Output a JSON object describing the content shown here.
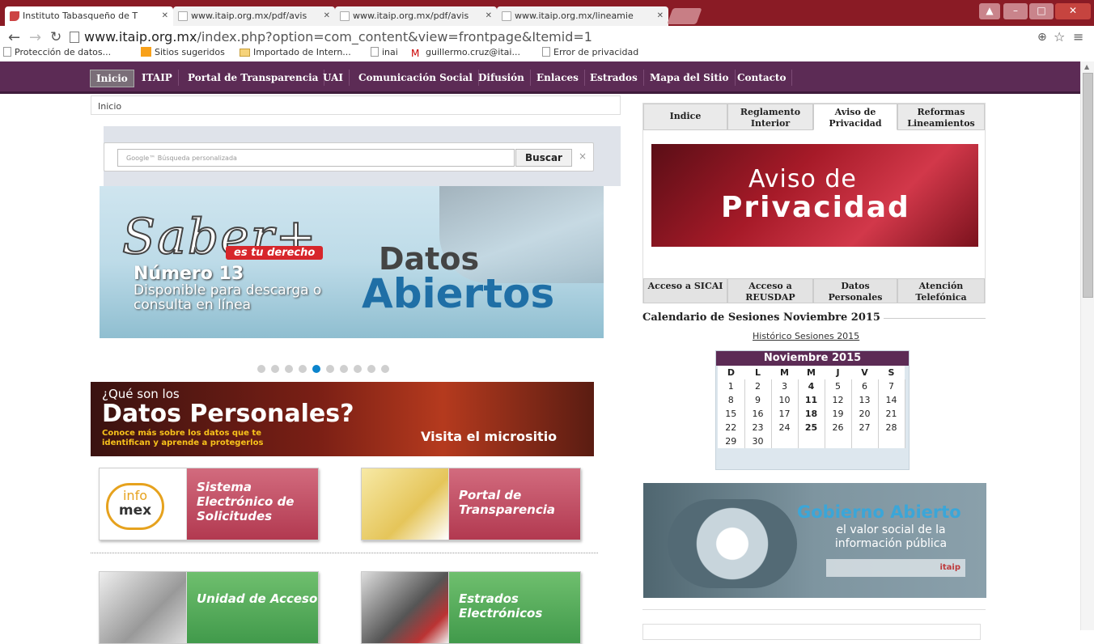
{
  "browser": {
    "tabs": [
      {
        "title": "Instituto Tabasqueño de T"
      },
      {
        "title": "www.itaip.org.mx/pdf/avis"
      },
      {
        "title": "www.itaip.org.mx/pdf/avis"
      },
      {
        "title": "www.itaip.org.mx/lineamie"
      }
    ],
    "url_domain": "www.itaip.org.mx",
    "url_path": "/index.php?option=com_content&view=frontpage&Itemid=1",
    "bookmarks": [
      {
        "label": "Protección de datos..."
      },
      {
        "label": "Sitios sugeridos"
      },
      {
        "label": "Importado de Intern..."
      },
      {
        "label": "inai"
      },
      {
        "label": "guillermo.cruz@itai..."
      },
      {
        "label": "Error de privacidad"
      }
    ]
  },
  "nav": {
    "items": [
      {
        "label": "Inicio"
      },
      {
        "label": "ITAIP"
      },
      {
        "label": "Portal de Transparencia"
      },
      {
        "label": "UAI"
      },
      {
        "label": "Comunicación Social"
      },
      {
        "label": "Difusión"
      },
      {
        "label": "Enlaces"
      },
      {
        "label": "Estrados"
      },
      {
        "label": "Mapa del Sitio"
      },
      {
        "label": "Contacto"
      }
    ]
  },
  "breadcrumb": "Inicio",
  "search": {
    "placeholder": "Google™ Búsqueda personalizada",
    "button": "Buscar",
    "clear": "×"
  },
  "banner": {
    "saber": "Saber+",
    "derecho": "es tu derecho",
    "numero": "Número 13",
    "disponible": "Disponible para descarga o consulta en línea",
    "datos": "Datos",
    "abiertos": "Abiertos"
  },
  "slider": {
    "count": 10,
    "active": 5
  },
  "datos_personales": {
    "question": "¿Qué son los",
    "title": "Datos Personales?",
    "sub": "Conoce más sobre los datos que te identifican y aprende a protegerlos",
    "cta": "Visita el micrositio"
  },
  "tiles": [
    {
      "label": "Sistema Electrónico de Solicitudes",
      "logo_top": "info",
      "logo_bottom": "mex"
    },
    {
      "label": "Portal de Transparencia"
    },
    {
      "label": "Unidad de Acceso"
    },
    {
      "label": "Estrados Electrónicos"
    }
  ],
  "right_tabs": [
    {
      "label": "Indice"
    },
    {
      "label": "Reglamento Interior"
    },
    {
      "label": "Aviso de Privacidad"
    },
    {
      "label": "Reformas Lineamientos"
    }
  ],
  "aviso": {
    "line1": "Aviso de",
    "line2": "Privacidad"
  },
  "bottom_tabs": [
    {
      "label": "Acceso a SICAI"
    },
    {
      "label": "Acceso a REUSDAP"
    },
    {
      "label": "Datos Personales"
    },
    {
      "label": "Atención Telefónica"
    }
  ],
  "calendar": {
    "heading": "Calendario de Sesiones Noviembre 2015",
    "historico": "Histórico Sesiones 2015",
    "month": "Noviembre 2015",
    "days": [
      "D",
      "L",
      "M",
      "M",
      "J",
      "V",
      "S"
    ],
    "weeks": [
      [
        "1",
        "2",
        "3",
        "4",
        "5",
        "6",
        "7"
      ],
      [
        "8",
        "9",
        "10",
        "11",
        "12",
        "13",
        "14"
      ],
      [
        "15",
        "16",
        "17",
        "18",
        "19",
        "20",
        "21"
      ],
      [
        "22",
        "23",
        "24",
        "25",
        "26",
        "27",
        "28"
      ],
      [
        "29",
        "30",
        "",
        "",
        "",
        "",
        ""
      ]
    ],
    "bold_days": [
      "4",
      "11",
      "18",
      "25"
    ]
  },
  "gobierno": {
    "title": "Gobierno Abierto",
    "sub": "el valor social de la información pública",
    "logo": "itaip"
  }
}
